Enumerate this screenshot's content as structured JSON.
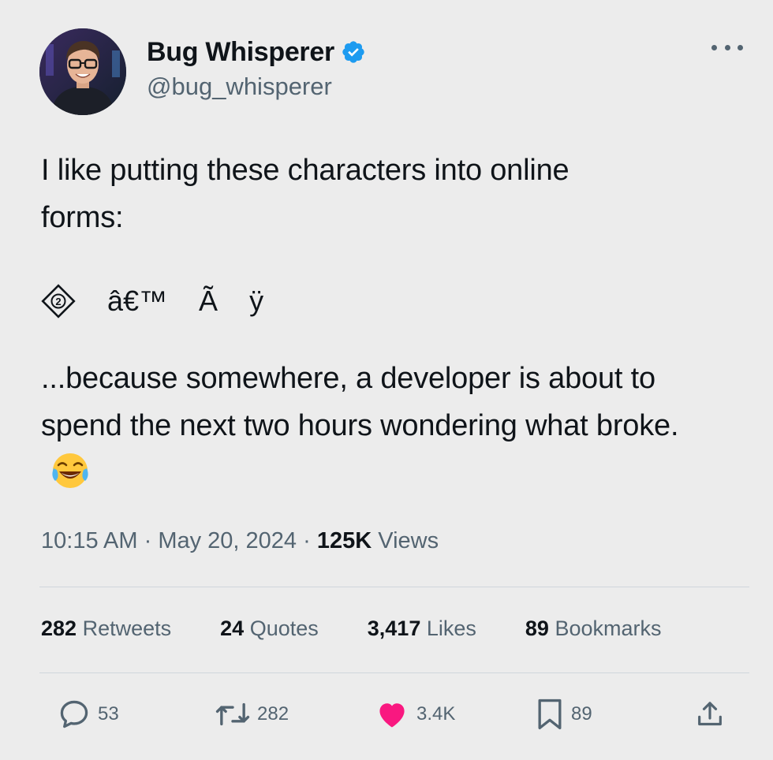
{
  "author": {
    "display_name": "Bug Whisperer",
    "handle": "@bug_whisperer",
    "verified": true
  },
  "tweet": {
    "intro": "I like putting these characters into online forms:",
    "characters": [
      "â€™",
      "Ã",
      "ÿ"
    ],
    "characters_icon": "replacement-character-diamond-icon",
    "punchline": "...because somewhere, a developer is about to spend the next two hours wondering what broke.",
    "emoji": "face-with-tears-of-joy-emoji"
  },
  "meta": {
    "time": "10:15 AM",
    "separator": "·",
    "date": "May 20, 2024",
    "views_count": "125K",
    "views_label": "Views"
  },
  "stats": [
    {
      "count": "282",
      "label": "Retweets"
    },
    {
      "count": "24",
      "label": "Quotes"
    },
    {
      "count": "3,417",
      "label": "Likes"
    },
    {
      "count": "89",
      "label": "Bookmarks"
    }
  ],
  "actions": {
    "reply": {
      "icon": "reply-icon",
      "count": "53"
    },
    "retweet": {
      "icon": "retweet-icon",
      "count": "282"
    },
    "like": {
      "icon": "heart-icon",
      "count": "3.4K",
      "color": "#f91880"
    },
    "bookmark": {
      "icon": "bookmark-icon",
      "count": "89"
    },
    "share": {
      "icon": "share-icon"
    }
  },
  "colors": {
    "background": "#ececec",
    "verified": "#1d9bf0",
    "secondary_text": "#536471",
    "like": "#f91880"
  }
}
